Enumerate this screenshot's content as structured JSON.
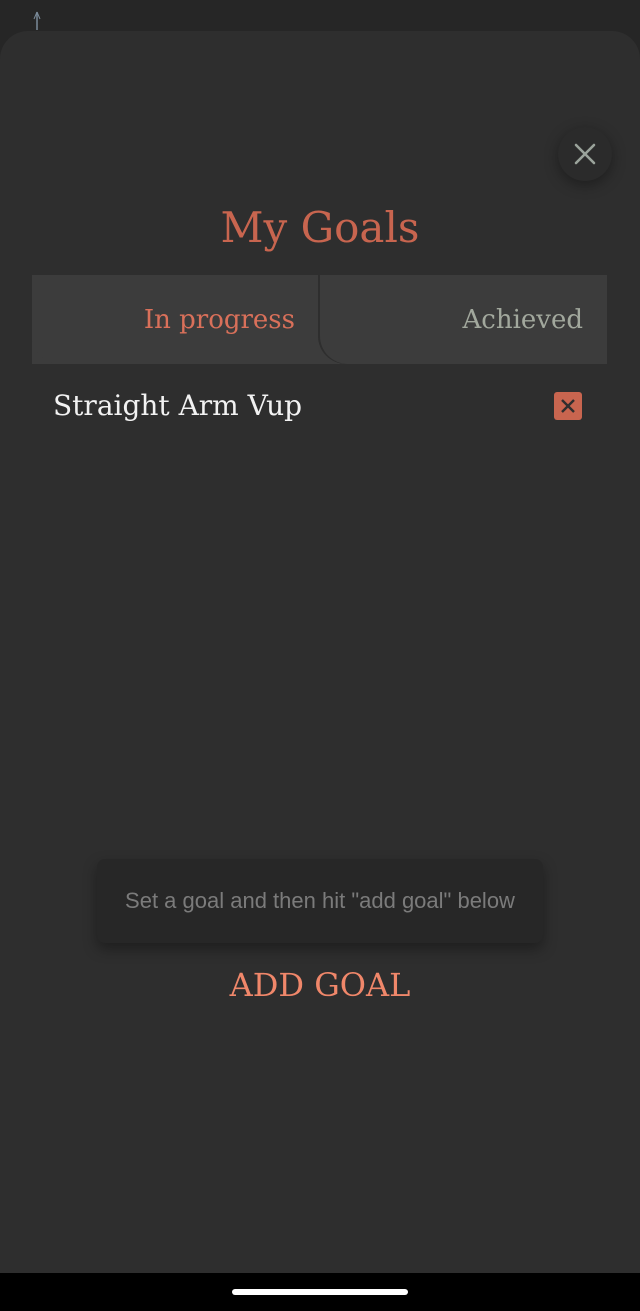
{
  "page": {
    "title": "My Goals"
  },
  "icons": {
    "status": "signal-icon",
    "close": "close-icon",
    "delete": "delete-icon"
  },
  "tabs": [
    {
      "label": "In progress",
      "active": true
    },
    {
      "label": "Achieved",
      "active": false
    }
  ],
  "goals": [
    {
      "label": "Straight Arm Vup"
    }
  ],
  "toast": {
    "message": "Set a goal and then hit \"add goal\" below"
  },
  "actions": {
    "add_goal_label": "ADD GOAL"
  },
  "colors": {
    "accent": "#c8654f",
    "active_tab": "#d9705a",
    "inactive_tab": "#a2a89d",
    "add_goal": "#f0876a",
    "background": "#2e2e2e"
  }
}
